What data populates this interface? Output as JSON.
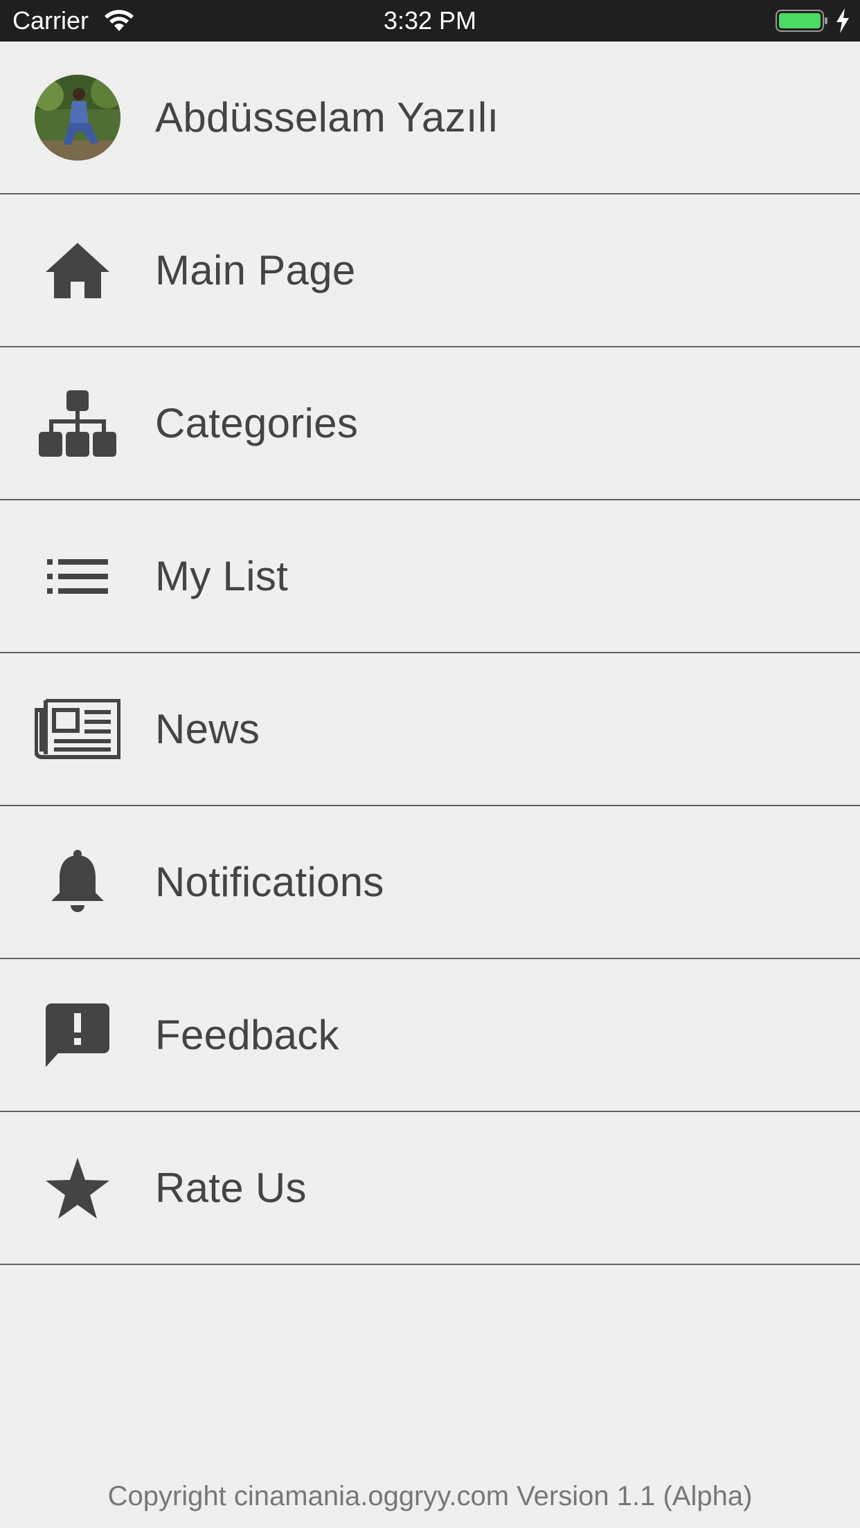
{
  "status_bar": {
    "carrier": "Carrier",
    "time": "3:32 PM",
    "battery_color": "#4cd964"
  },
  "profile": {
    "name": "Abdüsselam Yazılı"
  },
  "menu": {
    "items": [
      {
        "label": "Main Page",
        "icon": "home-icon"
      },
      {
        "label": "Categories",
        "icon": "sitemap-icon"
      },
      {
        "label": "My List",
        "icon": "list-icon"
      },
      {
        "label": "News",
        "icon": "newspaper-icon"
      },
      {
        "label": "Notifications",
        "icon": "bell-icon"
      },
      {
        "label": "Feedback",
        "icon": "feedback-icon"
      },
      {
        "label": "Rate Us",
        "icon": "star-icon"
      }
    ]
  },
  "footer": {
    "copyright": "Copyright cinamania.oggryy.com Version 1.1 (Alpha)"
  },
  "colors": {
    "background": "#efefef",
    "text": "#444444",
    "divider": "#5f5f5f",
    "status_bar": "#1f1f1f"
  }
}
